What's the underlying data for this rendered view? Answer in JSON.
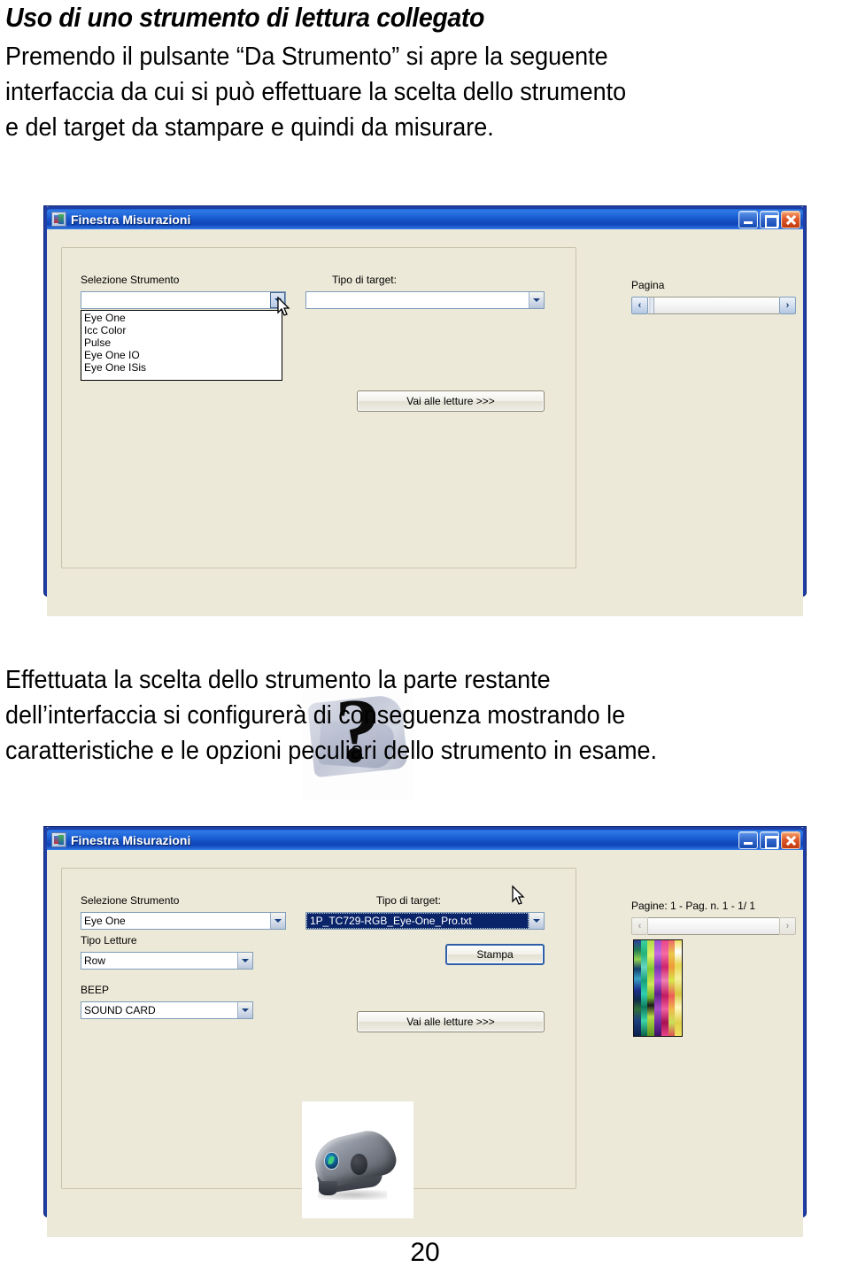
{
  "document": {
    "heading": "Uso di uno strumento di lettura collegato",
    "paragraph1_lines": [
      "Premendo il pulsante “Da Strumento” si apre la seguente",
      "interfaccia da cui si può effettuare la scelta dello strumento",
      "e del target da stampare e quindi da misurare."
    ],
    "paragraph2_lines": [
      "Effettuata la scelta dello strumento la parte restante",
      "dell’interfaccia si configurerà di conseguenza mostrando le",
      "caratteristiche e le opzioni peculiari dello strumento in esame."
    ],
    "page_number": "20"
  },
  "window1": {
    "title": "Finestra Misurazioni",
    "app_icon": "measurements-app-icon",
    "buttons": {
      "minimize": "minimize-button",
      "maximize": "maximize-button",
      "close": "close-button"
    },
    "instrument_group": {
      "instrument_label": "Selezione Strumento",
      "instrument_value": "",
      "target_label": "Tipo di target:",
      "target_value": "",
      "dropdown_open": true,
      "dropdown_options": [
        "Eye One",
        "Icc Color",
        "Pulse",
        "Eye One IO",
        "Eye One ISis"
      ],
      "go_button": "Vai alle letture >>>"
    },
    "page_panel": {
      "label": "Pagina",
      "prev": "‹",
      "next": "›"
    },
    "preview_image": "unknown-instrument-question-image"
  },
  "window2": {
    "title": "Finestra Misurazioni",
    "app_icon": "measurements-app-icon",
    "buttons": {
      "minimize": "minimize-button",
      "maximize": "maximize-button",
      "close": "close-button"
    },
    "instrument_group": {
      "instrument_label": "Selezione Strumento",
      "instrument_value": "Eye One",
      "reading_type_label": "Tipo Letture",
      "reading_type_value": "Row",
      "beep_label": "BEEP",
      "beep_value": "SOUND CARD",
      "target_label": "Tipo di target:",
      "target_value": "1P_TC729-RGB_Eye-One_Pro.txt",
      "target_selected": true,
      "print_button": "Stampa",
      "go_button": "Vai alle letture >>>"
    },
    "page_panel": {
      "label": "Pagine: 1 - Pag. n. 1 - 1/ 1",
      "prev": "‹",
      "next": "›"
    },
    "preview_image": "eye-one-instrument-image",
    "target_thumbnail": "color-target-chart-thumbnail"
  },
  "colors": {
    "title_bar_blue": "#1550c4",
    "window_face": "#ece9d8",
    "selection_blue": "#0a246a",
    "close_red": "#e05a2b"
  }
}
